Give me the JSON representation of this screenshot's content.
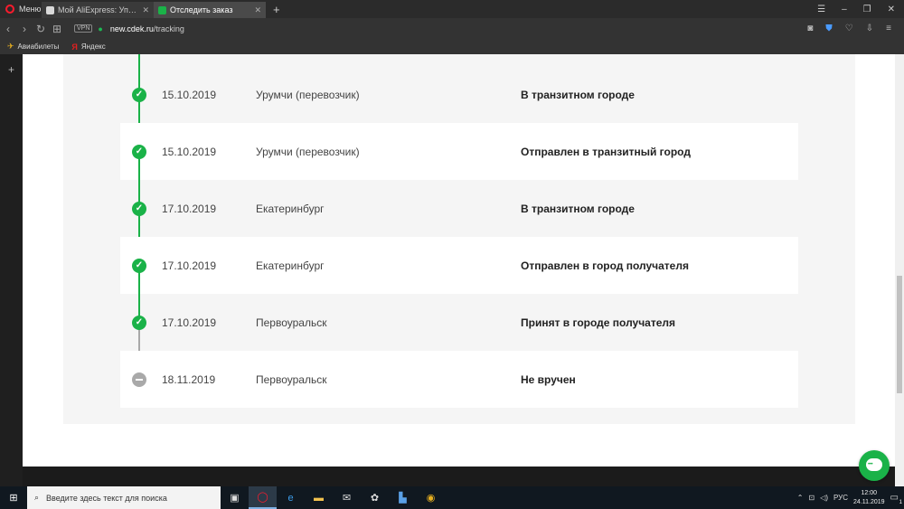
{
  "browser": {
    "menu_label": "Меню",
    "tabs": [
      {
        "title": "Мой AliExpress: Управлять",
        "active": false,
        "favicon_color": "#d9d9d9"
      },
      {
        "title": "Отследить заказ",
        "active": true,
        "favicon_color": "#1ab248"
      }
    ],
    "new_tab": "+",
    "window_controls": {
      "minimize": "–",
      "restore": "❐",
      "close": "✕"
    },
    "address": {
      "vpn": "VPN",
      "lock": "🔒",
      "domain": "new.cdek.ru",
      "path": "/tracking"
    },
    "bookmarks": [
      {
        "label": "Авиабилеты",
        "icon": "plane-icon"
      },
      {
        "label": "Яндекс",
        "icon": "yandex-icon"
      }
    ],
    "sidebar_add": "+"
  },
  "tracking": {
    "events": [
      {
        "date": "15.10.2019",
        "city": "Урумчи (перевозчик)",
        "status": "В транзитном городе",
        "state": "done"
      },
      {
        "date": "15.10.2019",
        "city": "Урумчи (перевозчик)",
        "status": "Отправлен в транзитный город",
        "state": "done"
      },
      {
        "date": "17.10.2019",
        "city": "Екатеринбург",
        "status": "В транзитном городе",
        "state": "done"
      },
      {
        "date": "17.10.2019",
        "city": "Екатеринбург",
        "status": "Отправлен в город получателя",
        "state": "done"
      },
      {
        "date": "17.10.2019",
        "city": "Первоуральск",
        "status": "Принят в городе получателя",
        "state": "done"
      },
      {
        "date": "18.11.2019",
        "city": "Первоуральск",
        "status": "Не вручен",
        "state": "pending"
      }
    ],
    "check_glyph": "✓",
    "colors": {
      "done": "#1ab248",
      "pending": "#a9a9a9"
    }
  },
  "taskbar": {
    "search_placeholder": "Введите здесь текст для поиска",
    "language": "РУС",
    "time": "12:00",
    "date": "24.11.2019",
    "notifications": "1"
  }
}
